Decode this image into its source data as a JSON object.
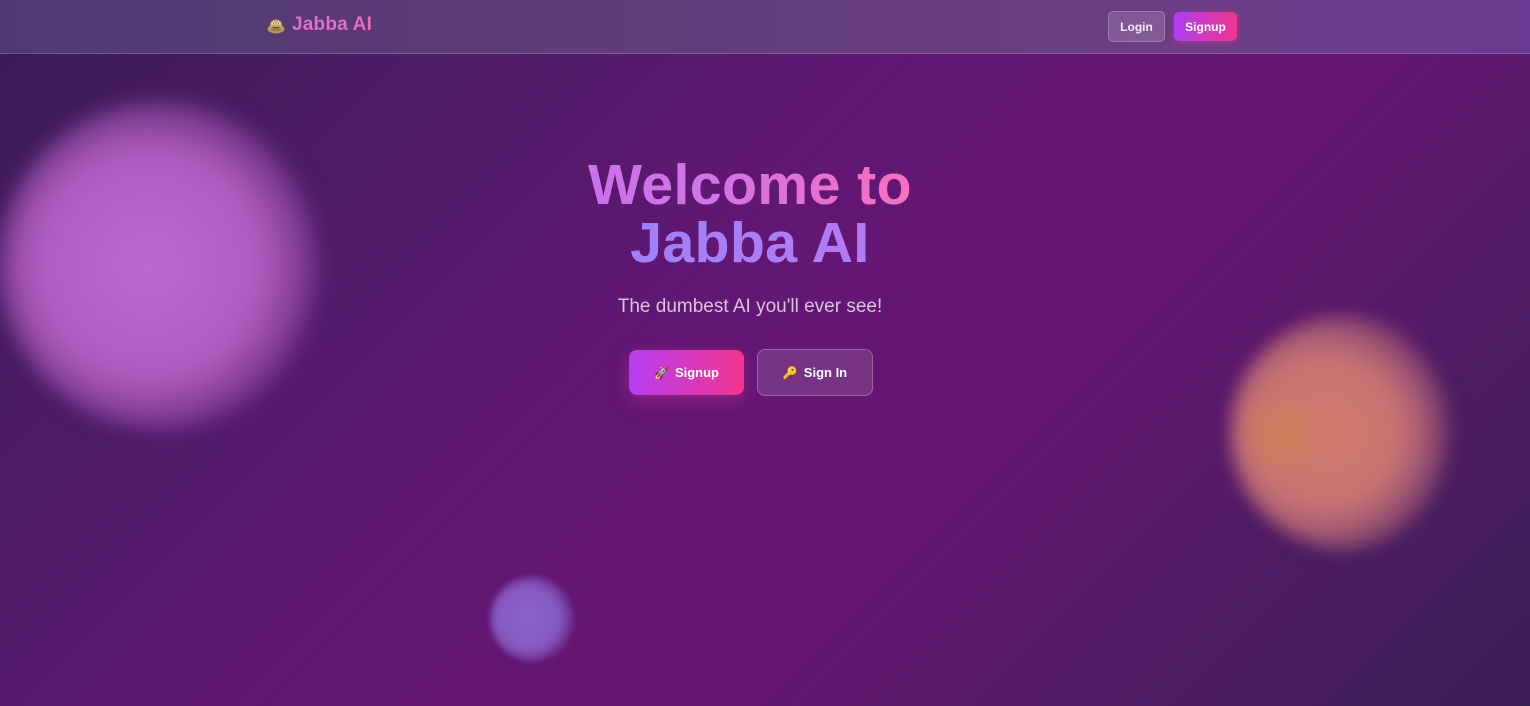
{
  "navbar": {
    "brand_icon": "jabba-icon",
    "brand_name": "Jabba AI",
    "login_label": "Login",
    "signup_label": "Signup"
  },
  "hero": {
    "title_line1": "Welcome to",
    "title_line2": "Jabba AI",
    "subtitle": "The dumbest AI you'll ever see!",
    "signup_button": {
      "icon": "rocket-icon",
      "glyph": "🚀",
      "label": "Signup"
    },
    "signin_button": {
      "icon": "key-icon",
      "glyph": "🔑",
      "label": "Sign In"
    }
  },
  "colors": {
    "accent_start": "#b53ef2",
    "accent_end": "#f4348c",
    "background": "#621774"
  }
}
